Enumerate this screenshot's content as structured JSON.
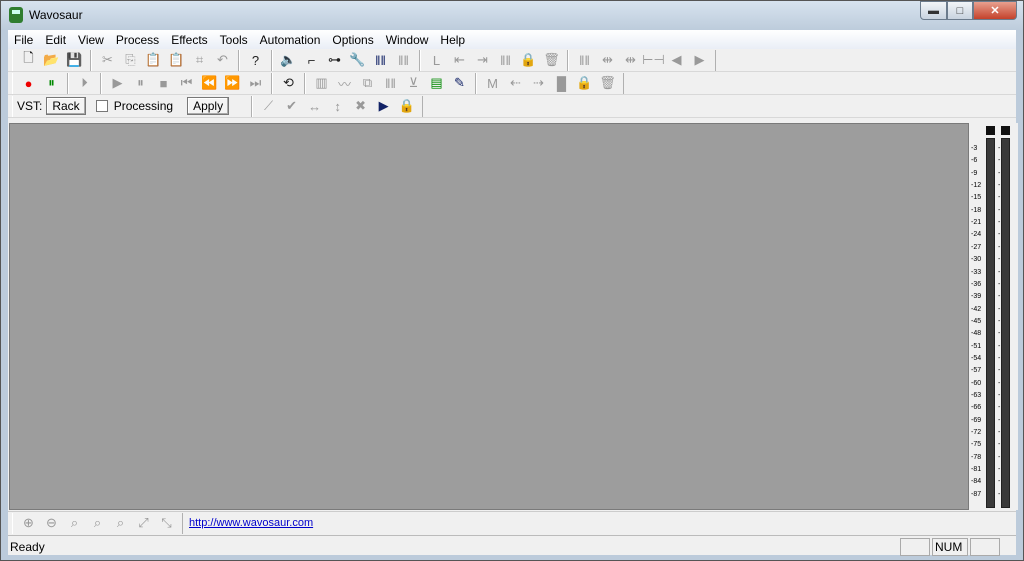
{
  "window": {
    "title": "Wavosaur",
    "minimize": "▬",
    "maximize": "□",
    "close": "✕"
  },
  "menu": [
    "File",
    "Edit",
    "View",
    "Process",
    "Effects",
    "Tools",
    "Automation",
    "Options",
    "Window",
    "Help"
  ],
  "toolbar1": [
    [
      {
        "name": "new-file-icon",
        "g": "🗋",
        "c": "on"
      },
      {
        "name": "open-folder-icon",
        "g": "📂",
        "c": "yel"
      },
      {
        "name": "save-icon",
        "g": "💾",
        "c": ""
      }
    ],
    [
      {
        "name": "cut-icon",
        "g": "✂",
        "c": ""
      },
      {
        "name": "copy-icon",
        "g": "⎘",
        "c": ""
      },
      {
        "name": "paste-icon",
        "g": "📋",
        "c": ""
      },
      {
        "name": "paste-mix-icon",
        "g": "📋",
        "c": ""
      },
      {
        "name": "crop-icon",
        "g": "⌗",
        "c": ""
      },
      {
        "name": "undo-icon",
        "g": "↶",
        "c": ""
      }
    ],
    [
      {
        "name": "help-icon",
        "g": "?",
        "c": "on"
      }
    ],
    [
      {
        "name": "speaker-icon",
        "g": "🔈",
        "c": "on"
      },
      {
        "name": "connect-icon",
        "g": "⌐",
        "c": "on"
      },
      {
        "name": "route-icon",
        "g": "⊶",
        "c": "on"
      },
      {
        "name": "wrench-icon",
        "g": "🔧",
        "c": "on"
      },
      {
        "name": "waveform-blue-icon",
        "g": "ǁǁ",
        "c": "blu"
      },
      {
        "name": "waveform-icon",
        "g": "ǁǁ",
        "c": ""
      }
    ],
    [
      {
        "name": "loop-start-icon",
        "g": "L",
        "c": ""
      },
      {
        "name": "loop-left-icon",
        "g": "⇤",
        "c": ""
      },
      {
        "name": "loop-right-icon",
        "g": "⇥",
        "c": ""
      },
      {
        "name": "waveform-loop-icon",
        "g": "ǁǁ",
        "c": ""
      },
      {
        "name": "lock-icon",
        "g": "🔒",
        "c": "yel"
      },
      {
        "name": "trash-icon",
        "g": "🗑",
        "c": ""
      }
    ],
    [
      {
        "name": "marker-icon",
        "g": "ǁǁ",
        "c": ""
      },
      {
        "name": "marker-prev-icon",
        "g": "⇹",
        "c": ""
      },
      {
        "name": "marker-next-icon",
        "g": "⇹",
        "c": ""
      },
      {
        "name": "marker-between-icon",
        "g": "⊢⊣",
        "c": ""
      },
      {
        "name": "arrow-left-icon",
        "g": "◀",
        "c": ""
      },
      {
        "name": "arrow-right-icon",
        "g": "▶",
        "c": ""
      }
    ]
  ],
  "toolbar2": [
    [
      {
        "name": "record-icon",
        "g": "●",
        "c": "red"
      },
      {
        "name": "record-pause-icon",
        "g": "⏸",
        "c": "grn"
      }
    ],
    [
      {
        "name": "play-from-start-icon",
        "g": "⏵",
        "c": ""
      }
    ],
    [
      {
        "name": "play-icon",
        "g": "▶",
        "c": ""
      },
      {
        "name": "pause-icon",
        "g": "⏸",
        "c": ""
      },
      {
        "name": "stop-icon",
        "g": "■",
        "c": ""
      },
      {
        "name": "go-start-icon",
        "g": "⏮",
        "c": ""
      },
      {
        "name": "rewind-icon",
        "g": "⏪",
        "c": ""
      },
      {
        "name": "fast-forward-icon",
        "g": "⏩",
        "c": ""
      },
      {
        "name": "go-end-icon",
        "g": "⏭",
        "c": ""
      }
    ],
    [
      {
        "name": "loop-icon",
        "g": "⟲",
        "c": "on"
      }
    ],
    [
      {
        "name": "normalize-icon",
        "g": "▥",
        "c": ""
      },
      {
        "name": "envelope-icon",
        "g": "〰",
        "c": ""
      },
      {
        "name": "duplicate-icon",
        "g": "⧉",
        "c": ""
      },
      {
        "name": "waveform-split-icon",
        "g": "ǁǁ",
        "c": ""
      },
      {
        "name": "threshold-icon",
        "g": "⊻",
        "c": ""
      },
      {
        "name": "spectrum-icon",
        "g": "▤",
        "c": "grn"
      },
      {
        "name": "pencil-icon",
        "g": "✎",
        "c": "blu"
      }
    ],
    [
      {
        "name": "marker-m-icon",
        "g": "M",
        "c": ""
      },
      {
        "name": "marker-m-left-icon",
        "g": "⇠",
        "c": ""
      },
      {
        "name": "marker-m-right-icon",
        "g": "⇢",
        "c": ""
      },
      {
        "name": "marker-block-icon",
        "g": "█",
        "c": ""
      },
      {
        "name": "marker-lock-icon",
        "g": "🔒",
        "c": "yel"
      },
      {
        "name": "marker-trash-icon",
        "g": "🗑",
        "c": ""
      }
    ]
  ],
  "vst": {
    "label": "VST:",
    "rack": "Rack",
    "processing": "Processing",
    "apply": "Apply"
  },
  "toolbar3": [
    {
      "name": "automation-curve-icon",
      "g": "⟋",
      "c": ""
    },
    {
      "name": "check-icon",
      "g": "✔",
      "c": ""
    },
    {
      "name": "horizontal-arrows-icon",
      "g": "↔",
      "c": ""
    },
    {
      "name": "vertical-arrows-icon",
      "g": "↕",
      "c": ""
    },
    {
      "name": "delete-x-icon",
      "g": "✖",
      "c": ""
    },
    {
      "name": "play-box-icon",
      "g": "▶",
      "c": "blu"
    },
    {
      "name": "automation-lock-icon",
      "g": "🔒",
      "c": "yel"
    }
  ],
  "meter": {
    "labels": [
      "-3",
      "-6",
      "-9",
      "-12",
      "-15",
      "-18",
      "-21",
      "-24",
      "-27",
      "-30",
      "-33",
      "-36",
      "-39",
      "-42",
      "-45",
      "-48",
      "-51",
      "-54",
      "-57",
      "-60",
      "-63",
      "-66",
      "-69",
      "-72",
      "-75",
      "-78",
      "-81",
      "-84",
      "-87"
    ],
    "level": 0
  },
  "bottom_toolbar": {
    "icons": [
      {
        "name": "zoom-in-icon",
        "g": "⊕"
      },
      {
        "name": "zoom-out-icon",
        "g": "⊖"
      },
      {
        "name": "zoom-fit-icon",
        "g": "⌕"
      },
      {
        "name": "zoom-vertical-in-icon",
        "g": "⌕"
      },
      {
        "name": "zoom-vertical-out-icon",
        "g": "⌕"
      },
      {
        "name": "zoom-selection-icon",
        "g": "⤢"
      },
      {
        "name": "zoom-restore-icon",
        "g": "⤡"
      }
    ],
    "link": "http://www.wavosaur.com"
  },
  "status": {
    "text": "Ready",
    "num": "NUM"
  }
}
